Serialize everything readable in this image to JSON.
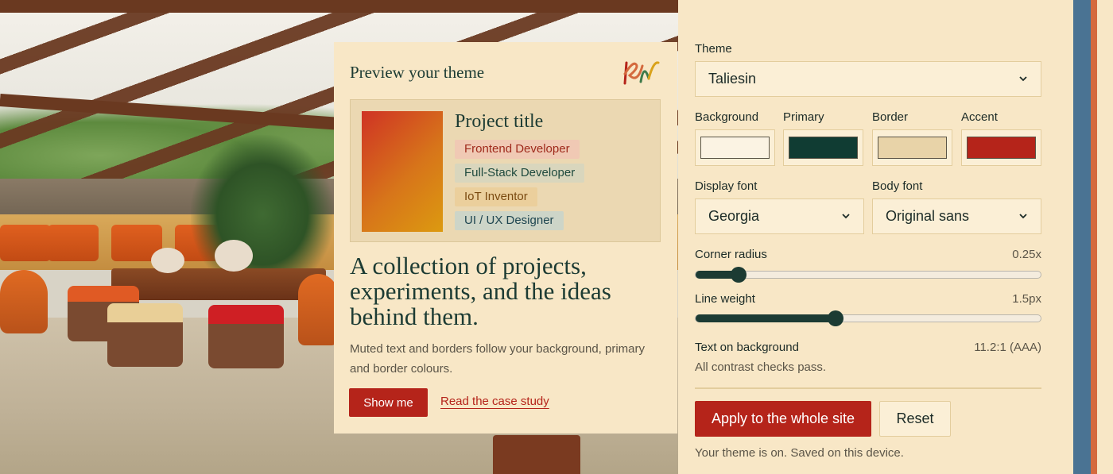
{
  "preview": {
    "title": "Preview your theme",
    "project_title": "Project title",
    "tags": [
      "Frontend Developer",
      "Full-Stack Developer",
      "IoT Inventor",
      "UI / UX Designer"
    ],
    "headline": "A collection of projects, experiments, and the ideas behind them.",
    "muted_text": "Muted text and borders follow your background, primary and border colours.",
    "show_button": "Show me",
    "case_link": "Read the case study"
  },
  "panel": {
    "theme_label": "Theme",
    "theme_value": "Taliesin",
    "colors": [
      {
        "label": "Background",
        "hex": "#fbf3e3"
      },
      {
        "label": "Primary",
        "hex": "#103c33"
      },
      {
        "label": "Border",
        "hex": "#e8d3a8"
      },
      {
        "label": "Accent",
        "hex": "#b5241a"
      }
    ],
    "display_font_label": "Display font",
    "display_font_value": "Georgia",
    "body_font_label": "Body font",
    "body_font_value": "Original sans",
    "corner_radius_label": "Corner radius",
    "corner_radius_value": "0.25x",
    "corner_radius_fraction": 0.12,
    "line_weight_label": "Line weight",
    "line_weight_value": "1.5px",
    "line_weight_fraction": 0.4,
    "contrast_label": "Text on background",
    "contrast_value": "11.2:1 (AAA)",
    "contrast_note": "All contrast checks pass.",
    "apply_button": "Apply to the whole site",
    "reset_button": "Reset",
    "status": "Your theme is on. Saved on this device."
  },
  "brand_colors": {
    "accent": "#b5241a",
    "primary": "#1c3b33",
    "stripe_blue": "#4a7393",
    "stripe_orange": "#d46a3e"
  },
  "icons": [
    "logo-icon",
    "chevron-down-icon"
  ]
}
